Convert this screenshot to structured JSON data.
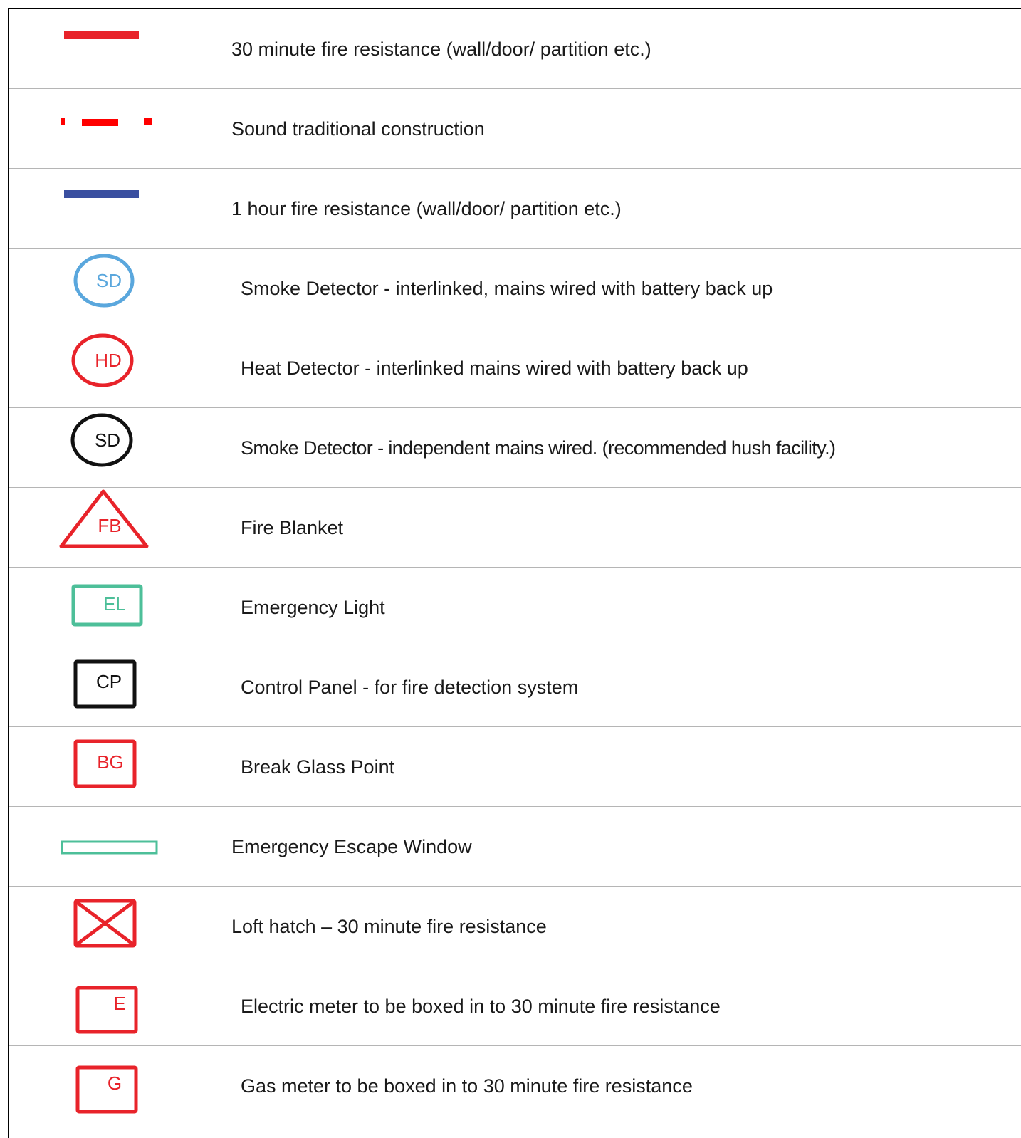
{
  "colors": {
    "red": "#e8232a",
    "blue": "#3a4fa0",
    "light_blue": "#5aa7dd",
    "teal": "#4dbf99",
    "black": "#111111"
  },
  "legend": [
    {
      "symbol": "red-line",
      "description": "30 minute fire resistance (wall/door/ partition etc.)"
    },
    {
      "symbol": "red-dash-dot-line",
      "description": "Sound traditional construction"
    },
    {
      "symbol": "blue-line",
      "description": "1 hour fire resistance (wall/door/ partition etc.)"
    },
    {
      "symbol": "blue-circle",
      "symbol_text": "SD",
      "description": "Smoke Detector - interlinked, mains wired with battery back up"
    },
    {
      "symbol": "red-circle",
      "symbol_text": "HD",
      "description": "Heat Detector - interlinked mains wired with battery back up"
    },
    {
      "symbol": "black-circle",
      "symbol_text": "SD",
      "description": "Smoke Detector - independent mains wired. (recommended hush facility.)"
    },
    {
      "symbol": "red-triangle",
      "symbol_text": "FB",
      "description": "Fire Blanket"
    },
    {
      "symbol": "teal-rectangle",
      "symbol_text": "EL",
      "description": "Emergency Light"
    },
    {
      "symbol": "black-square",
      "symbol_text": "CP",
      "description": "Control Panel - for fire detection system"
    },
    {
      "symbol": "red-square",
      "symbol_text": "BG",
      "description": "Break Glass Point"
    },
    {
      "symbol": "teal-outline-bar",
      "description": "Emergency Escape Window"
    },
    {
      "symbol": "red-crossed-square",
      "description": "Loft hatch – 30 minute fire resistance"
    },
    {
      "symbol": "red-square",
      "symbol_text": "E",
      "description": "Electric meter to be boxed in to 30 minute fire resistance"
    },
    {
      "symbol": "red-square",
      "symbol_text": "G",
      "description": "Gas meter to be boxed in to 30 minute fire resistance"
    }
  ]
}
